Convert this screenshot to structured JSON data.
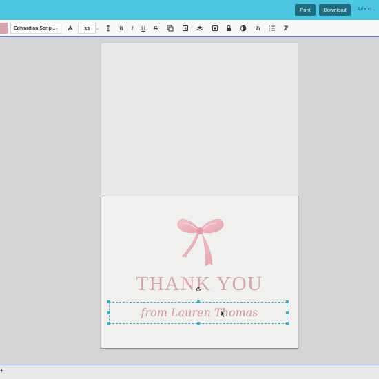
{
  "header": {
    "print_label": "Print",
    "download_label": "Download",
    "account_label": "Admin"
  },
  "toolbar": {
    "color_swatch": "#d9a2aa",
    "font_family": "Edwardian Scrip...",
    "font_size": "33",
    "tools": [
      "text-effect-icon",
      "line-spacing-icon",
      "bold-icon",
      "italic-icon",
      "underline-icon",
      "strikethrough-icon",
      "duplicate-icon",
      "layers-icon",
      "crop-icon",
      "delete-icon",
      "lock-icon",
      "color-fill-icon",
      "text-case-icon",
      "list-icon",
      "clear-format-icon"
    ]
  },
  "card": {
    "headline": "THANK YOU",
    "signature": "from Lauren Thomas",
    "accent": "#dba5ae"
  },
  "bottom": {
    "add_label": "+"
  }
}
